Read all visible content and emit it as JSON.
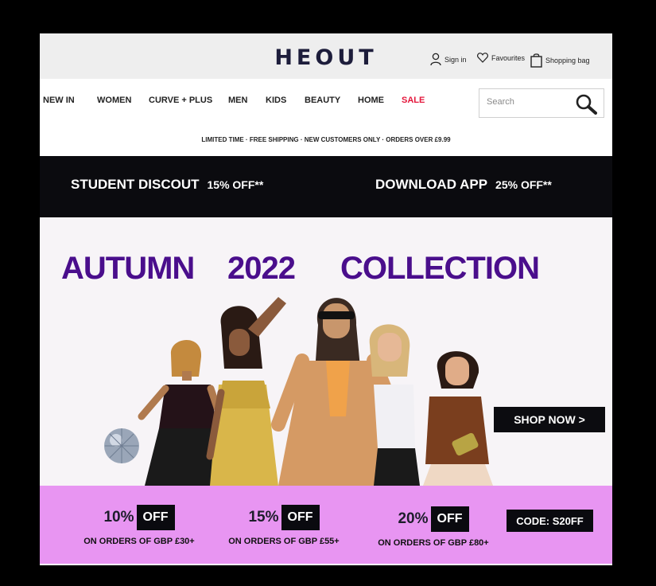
{
  "header": {
    "logo": "HEOUT",
    "sign_in": "Sign in",
    "favourites": "Favourites",
    "shopping_bag": "Shopping bag"
  },
  "nav": {
    "items": [
      "NEW IN",
      "WOMEN",
      "CURVE + PLUS",
      "MEN",
      "KIDS",
      "BEAUTY",
      "HOME",
      "SALE"
    ],
    "search_placeholder": "Search",
    "sale_color": "#e4163b"
  },
  "promo_strip": "LIMITED TIME · FREE SHIPPING · NEW CUSTOMERS ONLY · ORDERS OVER £9.99",
  "banner": {
    "student_label": "STUDENT DISCOUT",
    "student_offer": "15% OFF**",
    "app_label": "DOWNLOAD APP",
    "app_offer": "25% OFF**"
  },
  "hero": {
    "title_word1": "AUTUMN",
    "title_word2": "2022",
    "title_word3": "COLLECTION",
    "title_color": "#4a0e8c",
    "cta": "SHOP NOW >"
  },
  "offers": {
    "background": "#e895f2",
    "items": [
      {
        "pct": "10%",
        "off": "OFF",
        "text": "ON ORDERS OF GBP £30+"
      },
      {
        "pct": "15%",
        "off": "OFF",
        "text": "ON ORDERS OF GBP £55+"
      },
      {
        "pct": "20%",
        "off": "OFF",
        "text": "ON ORDERS OF GBP £80+"
      }
    ],
    "code": "CODE:  S20FF"
  }
}
